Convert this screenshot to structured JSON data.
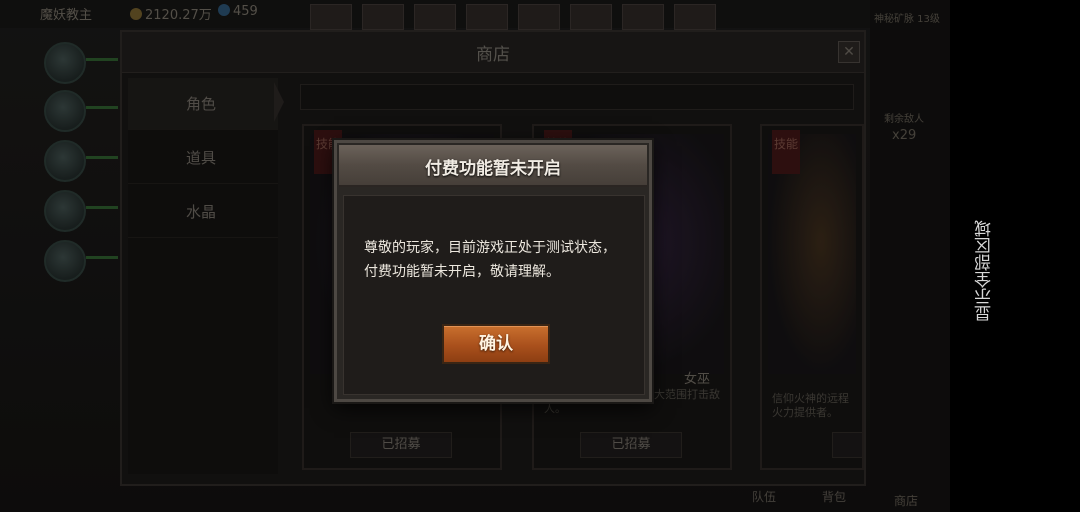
{
  "topbar": {
    "name": "魔妖教主",
    "gold": "2120.27万",
    "gems": "459"
  },
  "right_panel": {
    "mine_label": "神秘矿脉 13级",
    "enemies_label": "剩余敌人",
    "enemies_count": "x29",
    "shop_label": "商店"
  },
  "shop": {
    "title": "商店",
    "close_icon": "close-icon",
    "tabs": [
      "角色",
      "道具",
      "水晶"
    ],
    "cards": [
      {
        "tag": "技能",
        "name": "",
        "desc": "",
        "button": "已招募"
      },
      {
        "tag": "技能",
        "name": "女巫",
        "desc": "…研究，擅长使用魔法大范围打击敌人。",
        "button": "已招募"
      },
      {
        "tag": "技能",
        "name": "",
        "desc": "信仰火神的远程火力提供者。",
        "button": "已"
      }
    ],
    "bottom_tabs": [
      "队伍",
      "背包"
    ]
  },
  "modal": {
    "title": "付费功能暂未开启",
    "message": "尊敬的玩家，目前游戏正处于测试状态，付费功能暂未开启，敬请理解。",
    "confirm_label": "确认"
  },
  "side_label": "显示全部区域",
  "colors": {
    "confirm_button": "#b45a22",
    "modal_header": "#5a524a",
    "modal_body": "#1f1c1a"
  }
}
